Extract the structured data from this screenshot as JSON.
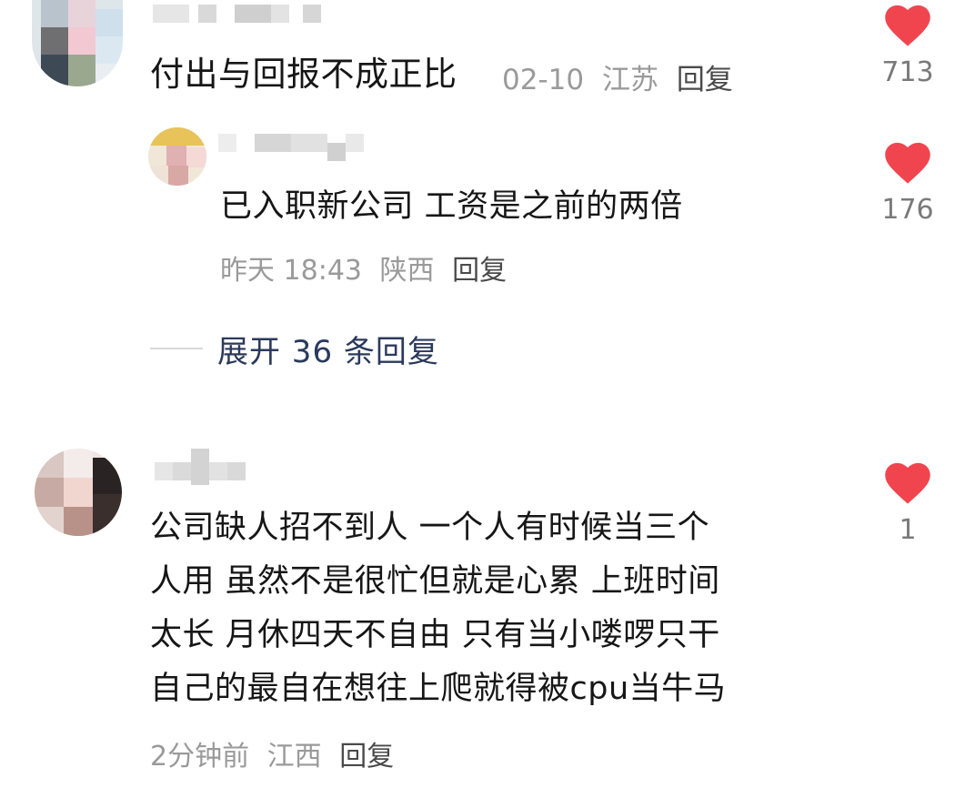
{
  "comments": [
    {
      "text": "付出与回报不成正比",
      "date": "02-10",
      "location": "江苏",
      "reply_label": "回复",
      "likes": "713"
    },
    {
      "text": "已入职新公司 工资是之前的两倍",
      "date": "昨天 18:43",
      "location": "陕西",
      "reply_label": "回复",
      "likes": "176"
    },
    {
      "text_lines": [
        "公司缺人招不到人 一个人有时候当三个",
        "人用 虽然不是很忙但就是心累 上班时间",
        "太长 月休四天不自由 只有当小喽啰只干",
        "自己的最自在想往上爬就得被cpu当牛马"
      ],
      "date": "2分钟前",
      "location": "江西",
      "reply_label": "回复",
      "likes": "1"
    }
  ],
  "expand_replies": {
    "label": "展开 36 条回复"
  },
  "colors": {
    "heart": "#f0454f",
    "text": "#161616",
    "meta": "#9a9a9a",
    "link": "#2b3a5c"
  },
  "icons": {
    "like": "heart-icon"
  }
}
